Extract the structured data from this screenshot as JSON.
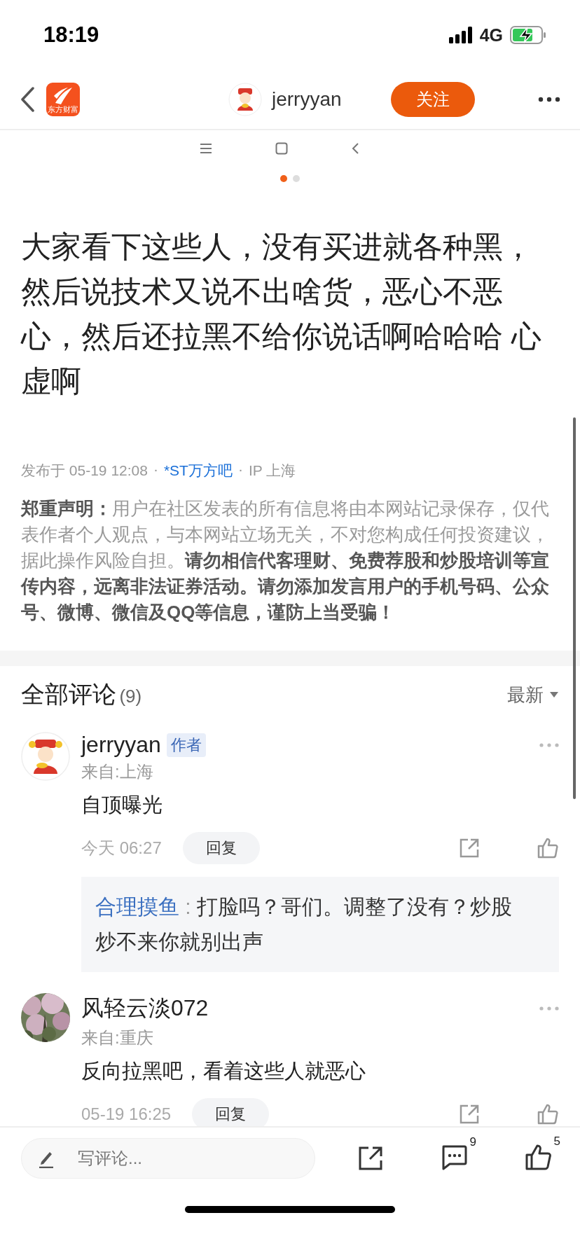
{
  "status_bar": {
    "time": "18:19",
    "network": "4G"
  },
  "nav": {
    "app_logo_text": "东方财富",
    "username": "jerryyan",
    "follow_button": "关注"
  },
  "image_toolbar": {
    "dots": [
      {
        "selected": true
      },
      {
        "selected": false
      }
    ]
  },
  "post": {
    "text": "大家看下这些人，没有买进就各种黑，然后说技术又说不出啥货，恶心不恶心，然后还拉黑不给你说话啊哈哈哈 心虚啊",
    "meta": {
      "published": "发布于 05-19 12:08",
      "separator_1": "·",
      "forum": "*ST万方吧",
      "separator_2": "·",
      "ip": "IP 上海"
    },
    "disclaimer": "**郑重声明：**用户在社区发表的所有信息将由本网站记录保存，仅代表作者个人观点，与本网站立场无关，不对您构成任何投资建议，据此操作风险自担。**请勿相信代客理财、免费荐股和炒股培训等宣传内容，远离非法证券活动。请勿添加发言用户的手机号码、公众号、微博、微信及QQ等信息，谨防上当受骗！**"
  },
  "comments": {
    "title": "全部评论",
    "count": "(9)",
    "sort": "最新",
    "items": [
      {
        "avatar": {
          "kind": "cartoon"
        },
        "author": "jerryyan",
        "badge": "作者",
        "location": "来自:上海",
        "text": "自顶曝光",
        "time": "今天 06:27",
        "reply_button": "回复",
        "replies": [
          {
            "author": "合理摸鱼",
            "separator": ":",
            "text": "打脸吗？哥们。调整了没有？炒股炒不来你就别出声"
          }
        ]
      },
      {
        "author": "风轻云淡072",
        "location": "来自:重庆",
        "text": "反向拉黑吧，看着这些人就恶心",
        "time": "05-19 16:25",
        "reply_button": "回复"
      }
    ]
  },
  "bottom_bar": {
    "placeholder": "写评论...",
    "comment_count": "9",
    "like_count": "5"
  }
}
